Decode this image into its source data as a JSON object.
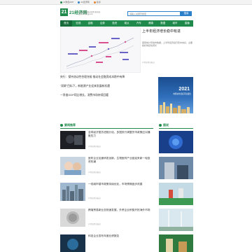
{
  "topbar": {
    "links": [
      {
        "label": "21财经APP",
        "color": "#1f8a4c"
      },
      {
        "label": "21经济网",
        "color": "#2c7fc9"
      },
      {
        "label": "投诉",
        "color": "#e8822e"
      }
    ]
  },
  "header": {
    "logo_mark": "21",
    "logo_text": "21经济网",
    "logo_sub": "21世纪经济报道官网 移动端访问m.21jingji.com",
    "search_placeholder": "请输入关键字搜索",
    "search_button": "搜索"
  },
  "nav": {
    "items": [
      "首页",
      "宏观",
      "金融",
      "证券",
      "投资",
      "观点",
      "汽车",
      "健康",
      "数据",
      "城市",
      "直播"
    ]
  },
  "hero": {
    "title": "上半年经济增长稳中有进",
    "desc": "国家统计局发布数据，上半年经济运行稳中向好，主要指标恢复性增长",
    "meta": "21世纪经济报道"
  },
  "headlines": [
    {
      "prefix": "",
      "text": "央行：保持流动性合理充裕 推动社会融资成本稳中有降"
    },
    {
      "prefix": "",
      "text": "“双碳”目标下，新能源产业迎来发展新机遇"
    },
    {
      "prefix": "",
      "text": "一季度GDP同比增长，消费市场持续回暖"
    }
  ],
  "ad": {
    "year": "2021",
    "sub": "中国城市营商环境报告"
  },
  "sections": {
    "left_title": "要闻推荐",
    "right_title": "图说"
  },
  "cards": [
    {
      "title": "全球经济复苏进程分化，多国央行调整货币政策应对通胀压力",
      "meta": "21世纪经济报道"
    },
    {
      "title": "医药企业加速研发创新，生物医药产业链迎来新一轮投资热潮",
      "meta": "21世纪经济报道"
    },
    {
      "title": "一线城市楼市政策持续优化，市场预期逐步改善",
      "meta": "21世纪经济报道"
    },
    {
      "title": "跨境贸易新业态快速发展，外贸企业积极开拓海外市场",
      "meta": "21世纪经济报道"
    },
    {
      "title": "科技企业发布年度业绩报告",
      "meta": "21世纪经济报道"
    }
  ]
}
